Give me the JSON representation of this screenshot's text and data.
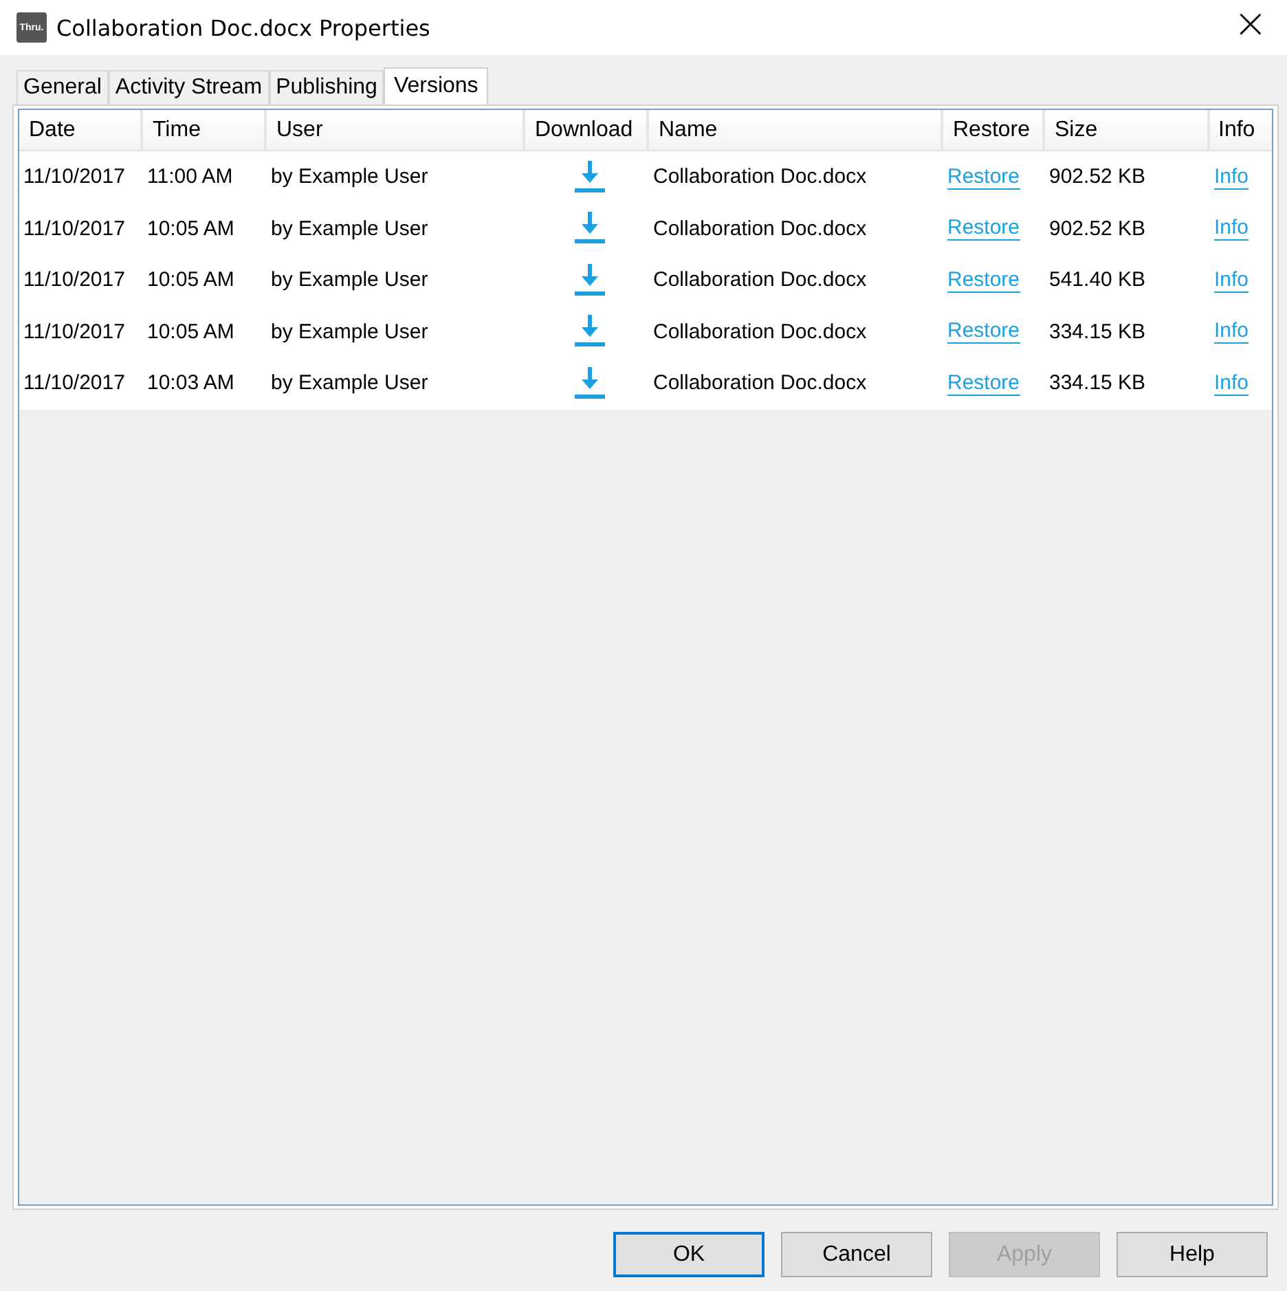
{
  "window": {
    "logo": "Thru.",
    "title": "Collaboration Doc.docx Properties",
    "close": "×"
  },
  "tabs": [
    {
      "label": "General",
      "selected": false
    },
    {
      "label": "Activity Stream",
      "selected": false
    },
    {
      "label": "Publishing",
      "selected": false
    },
    {
      "label": "Versions",
      "selected": true
    }
  ],
  "table": {
    "columns": [
      "Date",
      "Time",
      "User",
      "Download",
      "Name",
      "Restore",
      "Size",
      "Info"
    ],
    "rows": [
      {
        "date": "11/10/2017",
        "time": "11:00 AM",
        "user": "by Example User",
        "name": "Collaboration Doc.docx",
        "restore": "Restore",
        "size": "902.52 KB",
        "info": "Info"
      },
      {
        "date": "11/10/2017",
        "time": "10:05 AM",
        "user": "by Example User",
        "name": "Collaboration Doc.docx",
        "restore": "Restore",
        "size": "902.52 KB",
        "info": "Info"
      },
      {
        "date": "11/10/2017",
        "time": "10:05 AM",
        "user": "by Example User",
        "name": "Collaboration Doc.docx",
        "restore": "Restore",
        "size": "541.40 KB",
        "info": "Info"
      },
      {
        "date": "11/10/2017",
        "time": "10:05 AM",
        "user": "by Example User",
        "name": "Collaboration Doc.docx",
        "restore": "Restore",
        "size": "334.15 KB",
        "info": "Info"
      },
      {
        "date": "11/10/2017",
        "time": "10:03 AM",
        "user": "by Example User",
        "name": "Collaboration Doc.docx",
        "restore": "Restore",
        "size": "334.15 KB",
        "info": "Info"
      }
    ]
  },
  "buttons": [
    {
      "label": "OK",
      "default": true,
      "disabled": false
    },
    {
      "label": "Cancel",
      "default": false,
      "disabled": false
    },
    {
      "label": "Apply",
      "default": false,
      "disabled": true
    },
    {
      "label": "Help",
      "default": false,
      "disabled": false
    }
  ]
}
